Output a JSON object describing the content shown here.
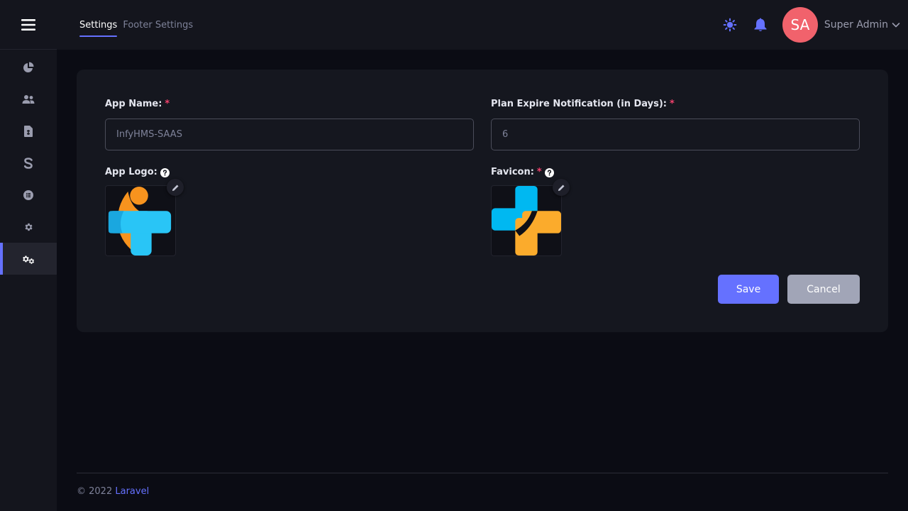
{
  "sidebar": {
    "items": [
      {
        "name": "dashboard",
        "icon": "pie-chart-icon"
      },
      {
        "name": "users",
        "icon": "users-icon"
      },
      {
        "name": "subscriptions",
        "icon": "file-invoice-icon"
      },
      {
        "name": "transactions",
        "icon": "dollar-icon"
      },
      {
        "name": "plans",
        "icon": "circle-list-icon"
      },
      {
        "name": "settings",
        "icon": "gear-icon"
      },
      {
        "name": "super-settings",
        "icon": "gears-icon",
        "active": true
      }
    ]
  },
  "header": {
    "tabs": [
      {
        "label": "Settings",
        "active": true
      },
      {
        "label": "Footer Settings",
        "active": false
      }
    ],
    "avatar_initials": "SA",
    "user_name": "Super Admin"
  },
  "form": {
    "app_name": {
      "label": "App Name:",
      "required": "*",
      "value": "InfyHMS-SAAS"
    },
    "plan_expire": {
      "label": "Plan Expire Notification (in Days):",
      "required": "*",
      "value": "6"
    },
    "app_logo": {
      "label": "App Logo:"
    },
    "favicon": {
      "label": "Favicon:",
      "required": "*"
    },
    "save_label": "Save",
    "cancel_label": "Cancel"
  },
  "footer": {
    "copyright": "© 2022",
    "link": "Laravel"
  },
  "colors": {
    "accent": "#6571ff",
    "avatar": "#f1626c",
    "required": "#f1416c",
    "logo_orange": "#f7931e",
    "logo_blue": "#29c5f6"
  }
}
